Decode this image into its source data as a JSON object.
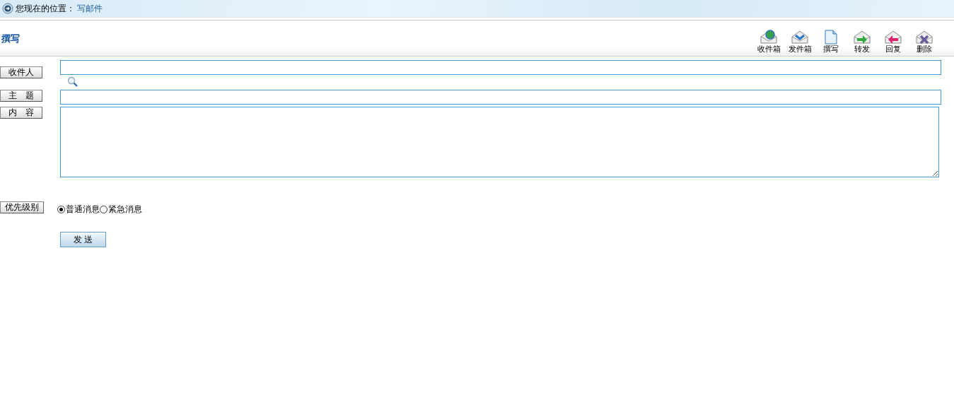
{
  "breadcrumb": {
    "label": "您现在的位置：",
    "link": "写邮件"
  },
  "header": {
    "title": "撰写"
  },
  "toolbar": [
    {
      "kind": "inbox",
      "label": "收件箱"
    },
    {
      "kind": "outbox",
      "label": "发件箱"
    },
    {
      "kind": "compose",
      "label": "撰写"
    },
    {
      "kind": "forward",
      "label": "转发"
    },
    {
      "kind": "reply",
      "label": "回复"
    },
    {
      "kind": "delete",
      "label": "删除"
    }
  ],
  "form": {
    "recipient_button": "收件人",
    "subject_label": "主　题",
    "content_label": "内　容",
    "priority_label": "优先级别",
    "priority_options": [
      {
        "label": "普通消息",
        "selected": true
      },
      {
        "label": "紧急消息",
        "selected": false
      }
    ],
    "send_button": "发 送"
  }
}
